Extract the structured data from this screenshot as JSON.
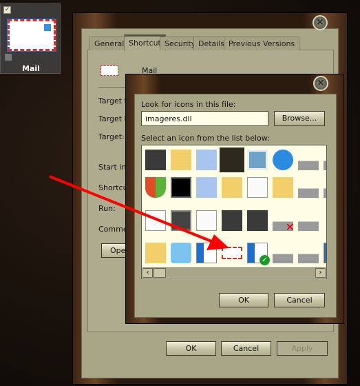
{
  "desktop": {
    "icon_label": "Mail"
  },
  "properties": {
    "tabs": [
      "General",
      "Shortcut",
      "Security",
      "Details",
      "Previous Versions"
    ],
    "active_tab": "Shortcut",
    "shortcut_name": "Mail",
    "labels": [
      "Target ty",
      "Target lo",
      "Target:",
      "Start in:",
      "Shortcut",
      "Run:",
      "Commen"
    ],
    "open_button": "Ope",
    "ok": "OK",
    "cancel": "Cancel",
    "apply": "Apply"
  },
  "change_icon": {
    "file_label": "Look for icons in this file:",
    "file_value": "imageres.dll",
    "browse": "Browse...",
    "list_label": "Select an icon from the list below:",
    "ok": "OK",
    "cancel": "Cancel",
    "icons": [
      [
        "slideshow-icon",
        "folder-icon",
        "document-folder-icon",
        "blank-dark-icon",
        "picture-icon",
        "network-globe-icon",
        "floppy-drive-icon",
        "drive-icon"
      ],
      [
        "security-shield-icon",
        "black-frame-icon",
        "folder-blue-icon",
        "folder-search-icon",
        "music-sheet-icon",
        "printer-folder-icon",
        "cd-drive-icon",
        "drive-icon"
      ],
      [
        "blank-page-icon",
        "frame-icon",
        "notepad-icon",
        "film-icon",
        "media-device-icon",
        "drive-error-icon",
        "drive-icon",
        ""
      ],
      [
        "folder-icon",
        "search-icon",
        "window-icon",
        "mail-envelope-icon",
        "window-check-icon",
        "floppy-drive-icon",
        "drive-icon",
        "windows-icon"
      ]
    ],
    "selected_icon": "blank-dark-icon"
  },
  "annotation": {
    "arrow_color": "#ff0000"
  }
}
